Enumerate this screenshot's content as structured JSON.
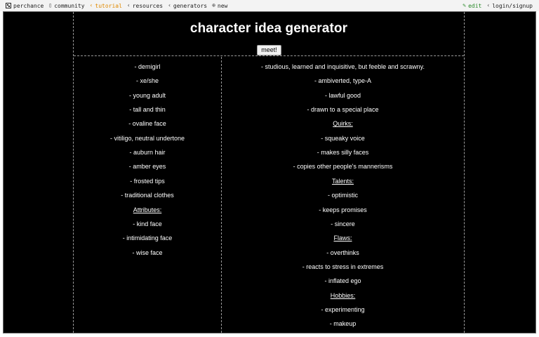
{
  "nav": {
    "brand": "perchance",
    "community": "community",
    "tutorial": "tutorial",
    "resources": "resources",
    "generators": "generators",
    "new": "new",
    "edit": "edit",
    "login": "login/signup"
  },
  "page": {
    "title": "character idea generator",
    "button_label": "meet!"
  },
  "left_column": [
    {
      "text": "- demigirl",
      "heading": false
    },
    {
      "text": "- xe/she",
      "heading": false
    },
    {
      "text": "- young adult",
      "heading": false
    },
    {
      "text": "- tall and thin",
      "heading": false
    },
    {
      "text": "- ovaline face",
      "heading": false
    },
    {
      "text": "- vitiligo, neutral undertone",
      "heading": false
    },
    {
      "text": "- auburn hair",
      "heading": false
    },
    {
      "text": "- amber eyes",
      "heading": false
    },
    {
      "text": "- frosted tips",
      "heading": false
    },
    {
      "text": "- traditional clothes",
      "heading": false
    },
    {
      "text": "Attributes:",
      "heading": true
    },
    {
      "text": "- kind face",
      "heading": false
    },
    {
      "text": "- intimidating face",
      "heading": false
    },
    {
      "text": "- wise face",
      "heading": false
    }
  ],
  "right_column": [
    {
      "text": "- studious, learned and inquisitive, but feeble and scrawny.",
      "heading": false
    },
    {
      "text": "- ambiverted, type-A",
      "heading": false
    },
    {
      "text": "- lawful good",
      "heading": false
    },
    {
      "text": "- drawn to a special place",
      "heading": false
    },
    {
      "text": "Quirks:",
      "heading": true
    },
    {
      "text": "- squeaky voice",
      "heading": false
    },
    {
      "text": "- makes silly faces",
      "heading": false
    },
    {
      "text": "- copies other people's mannerisms",
      "heading": false
    },
    {
      "text": "Talents:",
      "heading": true
    },
    {
      "text": "- optimistic",
      "heading": false
    },
    {
      "text": "- keeps promises",
      "heading": false
    },
    {
      "text": "- sincere",
      "heading": false
    },
    {
      "text": "Flaws:",
      "heading": true
    },
    {
      "text": "- overthinks",
      "heading": false
    },
    {
      "text": "- reacts to stress in extremes",
      "heading": false
    },
    {
      "text": "- inflated ego",
      "heading": false
    },
    {
      "text": "Hobbies:",
      "heading": true
    },
    {
      "text": "- experimenting",
      "heading": false
    },
    {
      "text": "- makeup",
      "heading": false
    }
  ]
}
